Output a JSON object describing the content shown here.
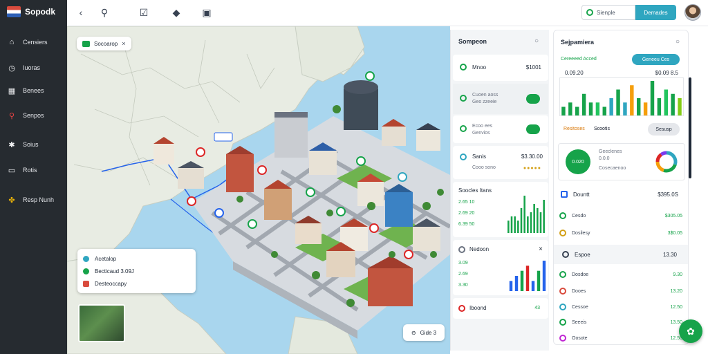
{
  "app": {
    "brand": "Sopodk"
  },
  "sidebar": {
    "items": [
      {
        "label": "Censiers",
        "icon": "home-icon"
      },
      {
        "label": "Iuoras",
        "icon": "clock-icon"
      },
      {
        "label": "Benees",
        "icon": "grid-icon"
      },
      {
        "label": "Senpos",
        "icon": "search-icon"
      },
      {
        "label": "Soius",
        "icon": "settings-icon"
      },
      {
        "label": "Rotis",
        "icon": "monitor-icon"
      },
      {
        "label": "Resp Nunh",
        "icon": "puzzle-icon"
      }
    ]
  },
  "topbar": {
    "search_text": "Sienple",
    "button_label": "Demades"
  },
  "map": {
    "chip_label": "Socoarop",
    "chip_close": "×",
    "route_label": "—",
    "legend": [
      {
        "label": "Acetalop",
        "color": "#2fa6c0"
      },
      {
        "label": "Becticaud 3.09J",
        "color": "#16a34a"
      },
      {
        "label": "Desteoccapy",
        "color": "#d94b3d"
      }
    ],
    "zoom_label": "Gide 3"
  },
  "panel1": {
    "title": "Sompeon",
    "row1": {
      "label": "Mnoo",
      "value": "$1001"
    },
    "row2": {
      "line1": "Cuoen aoss",
      "line2": "Geo zzeeie"
    },
    "row3": {
      "line1": "Ecoo ees",
      "line2": "Genvios"
    },
    "row4": {
      "label": "Sanis",
      "value": "$3.30.00",
      "sub": "Cooo sono"
    },
    "chart1": {
      "title": "Soocles Itans",
      "rows": [
        "2.65 10",
        "2.69 20",
        "6.39 50"
      ]
    },
    "chart2": {
      "title": "Nedoon",
      "close": "×",
      "rows": [
        "3.09",
        "2.69",
        "3.30"
      ]
    },
    "bottom": {
      "label": "Iboond",
      "value": "43"
    }
  },
  "panel2": {
    "title": "Sejpamiera",
    "subtitle": "Cereeeed Acced",
    "button": "Geneeu Ces",
    "value_left": "0.09.20",
    "value_right": "$0.09 8.5",
    "legend": [
      "Resitoses",
      "Scootis"
    ],
    "filter_button": "Sesusp",
    "donut": {
      "center_label": "0.020",
      "text1": "Geeclenes",
      "text2": "0.0.0",
      "text3": "Cosecaenoo"
    },
    "section1": {
      "title": "Dountt",
      "value": "$395.0S"
    },
    "rows1": [
      {
        "label": "Cesdo",
        "value": "$305.05",
        "color": "#16a34a"
      },
      {
        "label": "Dosilesy",
        "value": "3$0.05",
        "color": "#d4a017"
      }
    ],
    "section2": {
      "title": "Espoe",
      "value": "13.30"
    },
    "rows2": [
      {
        "label": "Dosdoe",
        "value": "9.30",
        "color": "#16a34a"
      },
      {
        "label": "Dooes",
        "value": "13.20",
        "color": "#d94b3d"
      },
      {
        "label": "Cessoe",
        "value": "12.50",
        "color": "#2fa6c0"
      },
      {
        "label": "Seeeis",
        "value": "13.50",
        "color": "#16a34a"
      },
      {
        "label": "Oosote",
        "value": "12.50",
        "color": "#c026d3"
      }
    ]
  },
  "chart_data": [
    {
      "type": "bar",
      "title": "Sejpamiera",
      "values": [
        2,
        3,
        2,
        5,
        3,
        3,
        2,
        4,
        6,
        3,
        7,
        4,
        3,
        8,
        4,
        6,
        5,
        4
      ],
      "colors": [
        "#16a34a",
        "#16a34a",
        "#16a34a",
        "#16a34a",
        "#16a34a",
        "#22c55e",
        "#16a34a",
        "#2fa6c0",
        "#16a34a",
        "#2fa6c0",
        "#f59e0b",
        "#16a34a",
        "#f59e0b",
        "#16a34a",
        "#16a34a",
        "#22c55e",
        "#16a34a",
        "#84cc16"
      ]
    },
    {
      "type": "bar",
      "title": "Soocles Itans",
      "values": [
        3,
        4,
        4,
        3,
        6,
        9,
        4,
        5,
        7,
        6,
        5,
        8
      ],
      "colors": [
        "#16a34a"
      ]
    },
    {
      "type": "bar",
      "title": "Nedoon",
      "values": [
        2,
        3,
        4,
        5,
        2,
        4,
        6
      ],
      "colors": [
        "#2563eb",
        "#2563eb",
        "#16a34a",
        "#dc2626",
        "#2563eb",
        "#16a34a",
        "#2563eb"
      ]
    },
    {
      "type": "pie",
      "title": "Geeclenes",
      "values": [
        30,
        25,
        20,
        15,
        10
      ],
      "colors": [
        "#2fa6c0",
        "#16a34a",
        "#f59e0b",
        "#dc2626",
        "#7c3aed"
      ]
    }
  ]
}
